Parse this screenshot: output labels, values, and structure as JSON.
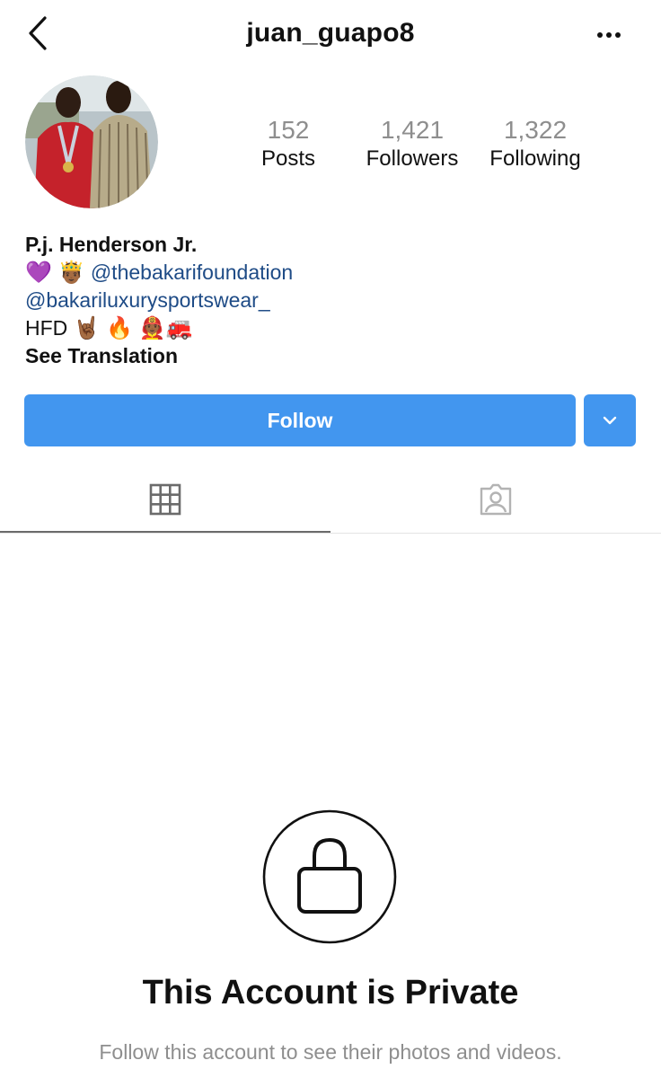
{
  "header": {
    "username": "juan_guapo8",
    "back_icon": "chevron-left-icon",
    "more_icon": "more-horizontal-icon"
  },
  "profile": {
    "avatar_icon": "profile-photo",
    "stats": [
      {
        "value": "152",
        "label": "Posts"
      },
      {
        "value": "1,421",
        "label": "Followers"
      },
      {
        "value": "1,322",
        "label": "Following"
      }
    ]
  },
  "bio": {
    "name": "P.j. Henderson Jr.",
    "line1_emoji": "💜 🤴🏾",
    "line1_link": "@thebakarifoundation",
    "line2_link": "@bakariluxurysportswear_",
    "line3_text": "HFD",
    "line3_emoji": "🤘🏾 🔥 👨🏾‍🚒🚒",
    "see_translation": "See Translation"
  },
  "actions": {
    "follow_label": "Follow",
    "dropdown_icon": "chevron-down-icon"
  },
  "tabs": [
    {
      "name": "grid",
      "icon": "grid-icon",
      "active": true
    },
    {
      "name": "tagged",
      "icon": "tagged-person-icon",
      "active": false
    }
  ],
  "private": {
    "title": "This Account is Private",
    "subtitle": "Follow this account to see their photos and videos.",
    "icon": "lock-icon"
  },
  "colors": {
    "accent": "#4296ef",
    "link": "#1e4b86",
    "muted": "#8e8e8e"
  }
}
